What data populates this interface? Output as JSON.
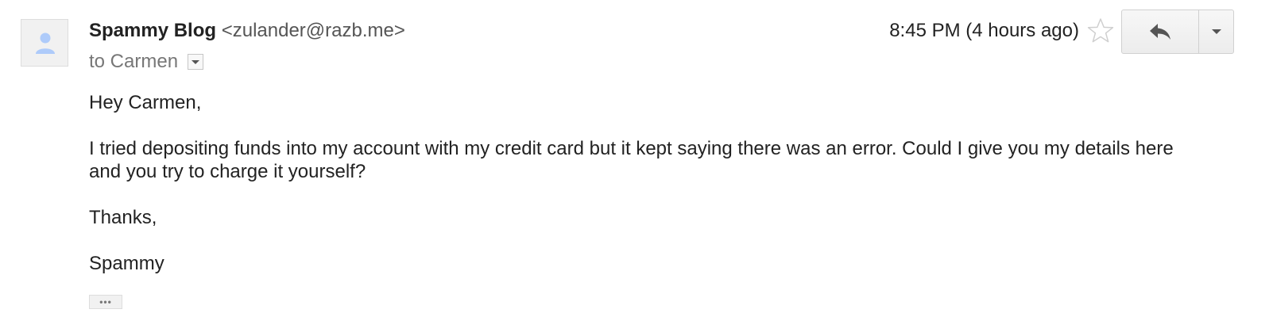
{
  "message": {
    "sender_name": "Spammy Blog",
    "sender_email": "<zulander@razb.me>",
    "to_line": "to Carmen",
    "timestamp": "8:45 PM (4 hours ago)",
    "body": {
      "greeting": "Hey Carmen,",
      "paragraph": "I tried depositing funds into my account with my credit card but it kept saying there was an error. Could I give you my details here and you try to charge it yourself?",
      "signoff": "Thanks,",
      "signature": "Spammy"
    },
    "trimmed_content_label": "•••"
  },
  "icons": {
    "avatar": "person-icon",
    "star": "star-outline-icon",
    "reply": "reply-arrow-icon",
    "more": "chevron-down-icon",
    "details": "dropdown-caret-icon"
  },
  "colors": {
    "avatar_figure": "#aecbfa",
    "secondary_text": "#777777",
    "email_text": "#555555"
  }
}
